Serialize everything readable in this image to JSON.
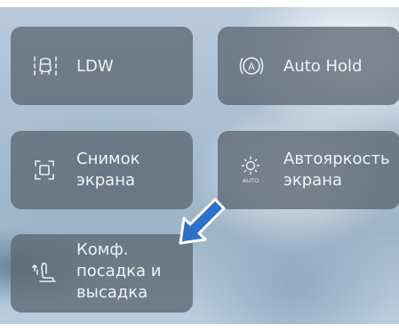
{
  "tiles": {
    "ldw": {
      "label": "LDW",
      "icon": "lane-departure-icon"
    },
    "auto_hold": {
      "label": "Auto Hold",
      "icon": "auto-hold-icon"
    },
    "screenshot": {
      "line1": "Снимок",
      "line2": "экрана",
      "icon": "screenshot-icon"
    },
    "auto_brightness": {
      "line1": "Автояркость",
      "line2": "экрана",
      "icon": "auto-brightness-icon",
      "icon_text": "AUTO"
    },
    "comfort_entry": {
      "line1": "Комф.",
      "line2": "посадка и",
      "line3": "высадка",
      "icon": "seat-easy-entry-icon"
    }
  },
  "annotation": {
    "icon": "pointer-arrow-icon",
    "color": "#2f6fc8"
  },
  "colors": {
    "tile_bg": "#5c6773",
    "text": "#eef3f7"
  }
}
